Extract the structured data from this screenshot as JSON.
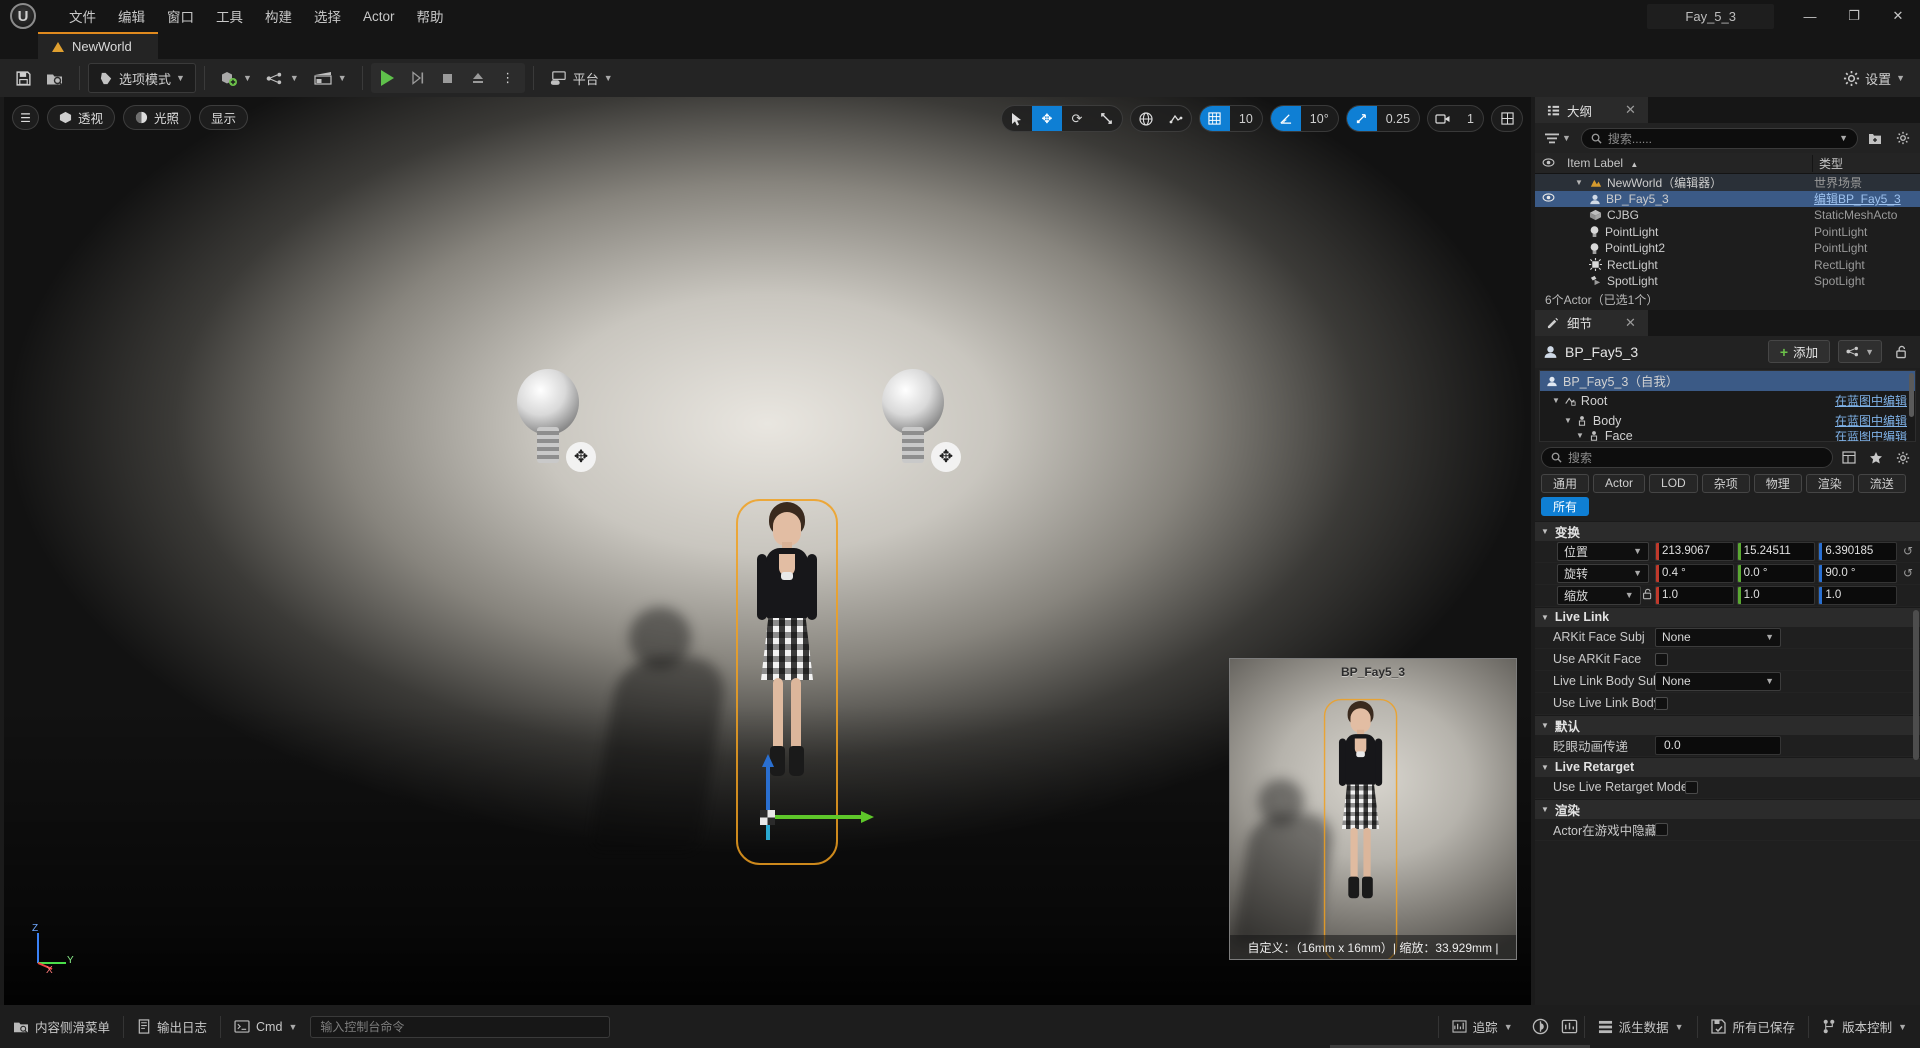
{
  "titlebar": {
    "menus": [
      "文件",
      "编辑",
      "窗口",
      "工具",
      "构建",
      "选择",
      "Actor",
      "帮助"
    ],
    "project_name": "Fay_5_3",
    "minimize": "—",
    "maximize": "❐",
    "close": "✕"
  },
  "tabstrip": {
    "world_tab": "NewWorld"
  },
  "toolbar": {
    "save_icon": "save-icon",
    "browse_icon": "content-browser-icon",
    "mode_label": "选项模式",
    "add_label": "add-actor-icon",
    "blueprint_label": "blueprints-icon",
    "sequencer_label": "cinematics-icon",
    "play_label": "play-icon",
    "skip_label": "skip-icon",
    "stop_label": "stop-icon",
    "eject_label": "eject-icon",
    "more_label": "⋮",
    "platform_label": "平台",
    "settings_label": "设置"
  },
  "viewport": {
    "menu_icon": "hamburger-menu-icon",
    "view_mode": "透视",
    "lighting_mode": "光照",
    "show_menu": "显示",
    "gizmos": [
      "select-arrow-icon",
      "move-icon",
      "rotate-icon",
      "scale-icon"
    ],
    "active_gizmo_index": 1,
    "coord_icon": "world-coordinate-icon",
    "surface_snap_icon": "surface-snap-icon",
    "grid_snap_value": "10",
    "angle_snap_value": "10°",
    "scale_snap_value": "0.25",
    "camera_speed_value": "1",
    "axis_labels": {
      "z": "Z",
      "x": "X",
      "y": "Y"
    },
    "pip": {
      "title": "BP_Fay5_3",
      "footer": "自定义：（16mm x 16mm）| 缩放：33.929mm |"
    }
  },
  "outliner": {
    "tab_label": "大纲",
    "close": "✕",
    "search_placeholder": "搜索......",
    "columns": {
      "label": "Item Label",
      "sort_arrow": "▲",
      "type": "类型"
    },
    "rows": [
      {
        "label": "NewWorld（编辑器）",
        "type": "世界场景",
        "icon": "world-icon",
        "indent": 14,
        "expandable": true,
        "selected": false,
        "eye": false
      },
      {
        "label": "BP_Fay5_3",
        "type": "编辑BP_Fay5_3",
        "icon": "blueprint-actor-icon",
        "indent": 28,
        "expandable": false,
        "selected": true,
        "eye": true
      },
      {
        "label": "CJBG",
        "type": "StaticMeshActo",
        "icon": "static-mesh-icon",
        "indent": 28,
        "expandable": false,
        "selected": false,
        "eye": false
      },
      {
        "label": "PointLight",
        "type": "PointLight",
        "icon": "point-light-icon",
        "indent": 28,
        "expandable": false,
        "selected": false,
        "eye": false
      },
      {
        "label": "PointLight2",
        "type": "PointLight",
        "icon": "point-light-icon",
        "indent": 28,
        "expandable": false,
        "selected": false,
        "eye": false
      },
      {
        "label": "RectLight",
        "type": "RectLight",
        "icon": "rect-light-icon",
        "indent": 28,
        "expandable": false,
        "selected": false,
        "eye": false
      },
      {
        "label": "SpotLight",
        "type": "SpotLight",
        "icon": "spot-light-icon",
        "indent": 28,
        "expandable": false,
        "selected": false,
        "eye": false
      }
    ],
    "footer": "6个Actor（已选1个）"
  },
  "details": {
    "tab_label": "细节",
    "close": "✕",
    "actor_name": "BP_Fay5_3",
    "add_label": "添加",
    "component_dropdown_icon": "components-icon",
    "lock_icon": "unlock-icon",
    "component_tree": [
      {
        "label": "BP_Fay5_3（自我）",
        "link": "",
        "indent": 6,
        "selected": true,
        "expandable": false
      },
      {
        "label": "Root",
        "link": "在蓝图中编辑",
        "indent": 18,
        "selected": false,
        "expandable": true
      },
      {
        "label": "Body",
        "link": "在蓝图中编辑",
        "indent": 30,
        "selected": false,
        "expandable": true
      },
      {
        "label": "Face",
        "link": "在蓝图中编辑",
        "indent": 42,
        "selected": false,
        "expandable": true
      }
    ],
    "search_placeholder": "搜索",
    "filters": [
      "通用",
      "Actor",
      "LOD",
      "杂项",
      "物理",
      "渲染",
      "流送",
      "所有"
    ],
    "active_filter": "所有",
    "sections": {
      "transform": {
        "title": "变换",
        "rows": [
          {
            "label": "位置",
            "x": "213.9067",
            "y": "15.24511",
            "z": "6.390185",
            "reset": true,
            "lock": false
          },
          {
            "label": "旋转",
            "x": "0.4 °",
            "y": "0.0 °",
            "z": "90.0 °",
            "reset": true,
            "lock": false
          },
          {
            "label": "缩放",
            "x": "1.0",
            "y": "1.0",
            "z": "1.0",
            "reset": false,
            "lock": true
          }
        ]
      },
      "livelink": {
        "title": "Live Link",
        "rows": [
          {
            "label": "ARKit Face Subj",
            "type": "combo",
            "value": "None"
          },
          {
            "label": "Use ARKit Face",
            "type": "checkbox",
            "value": ""
          },
          {
            "label": "Live Link Body Subj",
            "type": "combo",
            "value": "None"
          },
          {
            "label": "Use Live Link Body",
            "type": "checkbox",
            "value": ""
          }
        ]
      },
      "default": {
        "title": "默认",
        "rows": [
          {
            "label": "眨眼动画传递",
            "type": "text",
            "value": "0.0"
          }
        ]
      },
      "retarget": {
        "title": "Live Retarget",
        "rows": [
          {
            "label": "Use Live Retarget Mode",
            "type": "checkbox",
            "value": ""
          }
        ]
      },
      "render": {
        "title": "渲染",
        "rows": [
          {
            "label": "Actor在游戏中隐藏",
            "type": "checkbox",
            "value": ""
          }
        ]
      }
    }
  },
  "statusbar": {
    "content_drawer": "内容侧滑菜单",
    "output_log": "输出日志",
    "cmd_label": "Cmd",
    "cmd_placeholder": "输入控制台命令",
    "trace_label": "追踪",
    "derived_data": "派生数据",
    "all_saved": "所有已保存",
    "source_control": "版本控制"
  },
  "colors": {
    "accent_blue": "#0f7fd4",
    "selection_blue": "#3b5a86",
    "orange": "#e08a1e",
    "green": "#6cc24a",
    "axis_x": "#c0392b",
    "axis_y": "#5aa832",
    "axis_z": "#2a6fd0"
  }
}
